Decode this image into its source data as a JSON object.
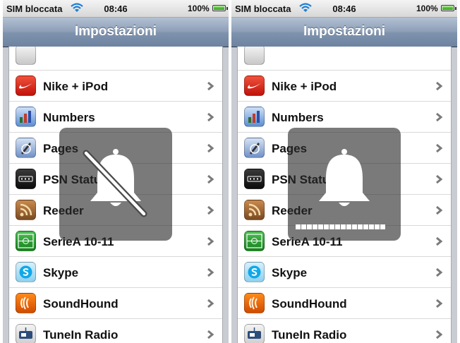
{
  "status_bar": {
    "carrier": "SIM bloccata",
    "time": "08:46",
    "battery_percent": "100%",
    "wifi_icon": "wifi-icon"
  },
  "navbar": {
    "title": "Impostazioni"
  },
  "settings_list": {
    "items": [
      {
        "label": "",
        "icon": "partial-app-icon"
      },
      {
        "label": "Nike + iPod",
        "icon": "nike-icon"
      },
      {
        "label": "Numbers",
        "icon": "numbers-icon"
      },
      {
        "label": "Pages",
        "icon": "pages-icon"
      },
      {
        "label": "PSN Status",
        "icon": "psn-icon"
      },
      {
        "label": "Reeder",
        "icon": "reeder-icon"
      },
      {
        "label": "SerieA 10-11",
        "icon": "seriea-icon"
      },
      {
        "label": "Skype",
        "icon": "skype-icon"
      },
      {
        "label": "SoundHound",
        "icon": "soundhound-icon"
      },
      {
        "label": "TuneIn Radio",
        "icon": "tunein-icon"
      }
    ]
  },
  "overlays": {
    "left": {
      "type": "silent-mode",
      "icon": "bell-muted-icon"
    },
    "right": {
      "type": "ringer-volume",
      "icon": "bell-icon",
      "volume_level": 1.0,
      "volume_steps": 16
    }
  },
  "colors": {
    "navbar_top": "#b3c0d2",
    "navbar_bottom": "#6d83a1",
    "hud": "#282828"
  }
}
